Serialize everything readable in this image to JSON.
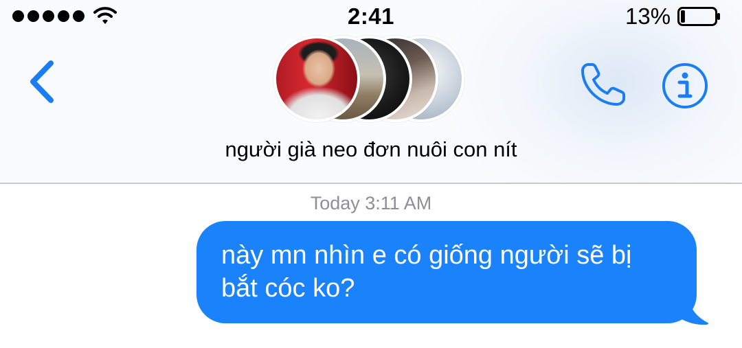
{
  "status_bar": {
    "signal_dots": 5,
    "wifi_icon": "wifi-icon",
    "time": "2:41",
    "battery_percent": "13%",
    "battery_level": 0.13,
    "battery_icon": "battery-icon"
  },
  "nav": {
    "back_icon": "chevron-left-icon",
    "group_name": "người già neo đơn nuôi con nít",
    "avatar_count": 5,
    "call_icon": "phone-icon",
    "info_icon": "info-icon",
    "accent_color": "#1a7ef2"
  },
  "conversation": {
    "timestamp": "Today 3:11 AM",
    "messages": [
      {
        "direction": "outgoing",
        "text_line1": "này mn nhìn e có giống người sẽ bị",
        "text_line2": "bắt cóc ko?",
        "bubble_color": "#1a82fb"
      }
    ]
  }
}
